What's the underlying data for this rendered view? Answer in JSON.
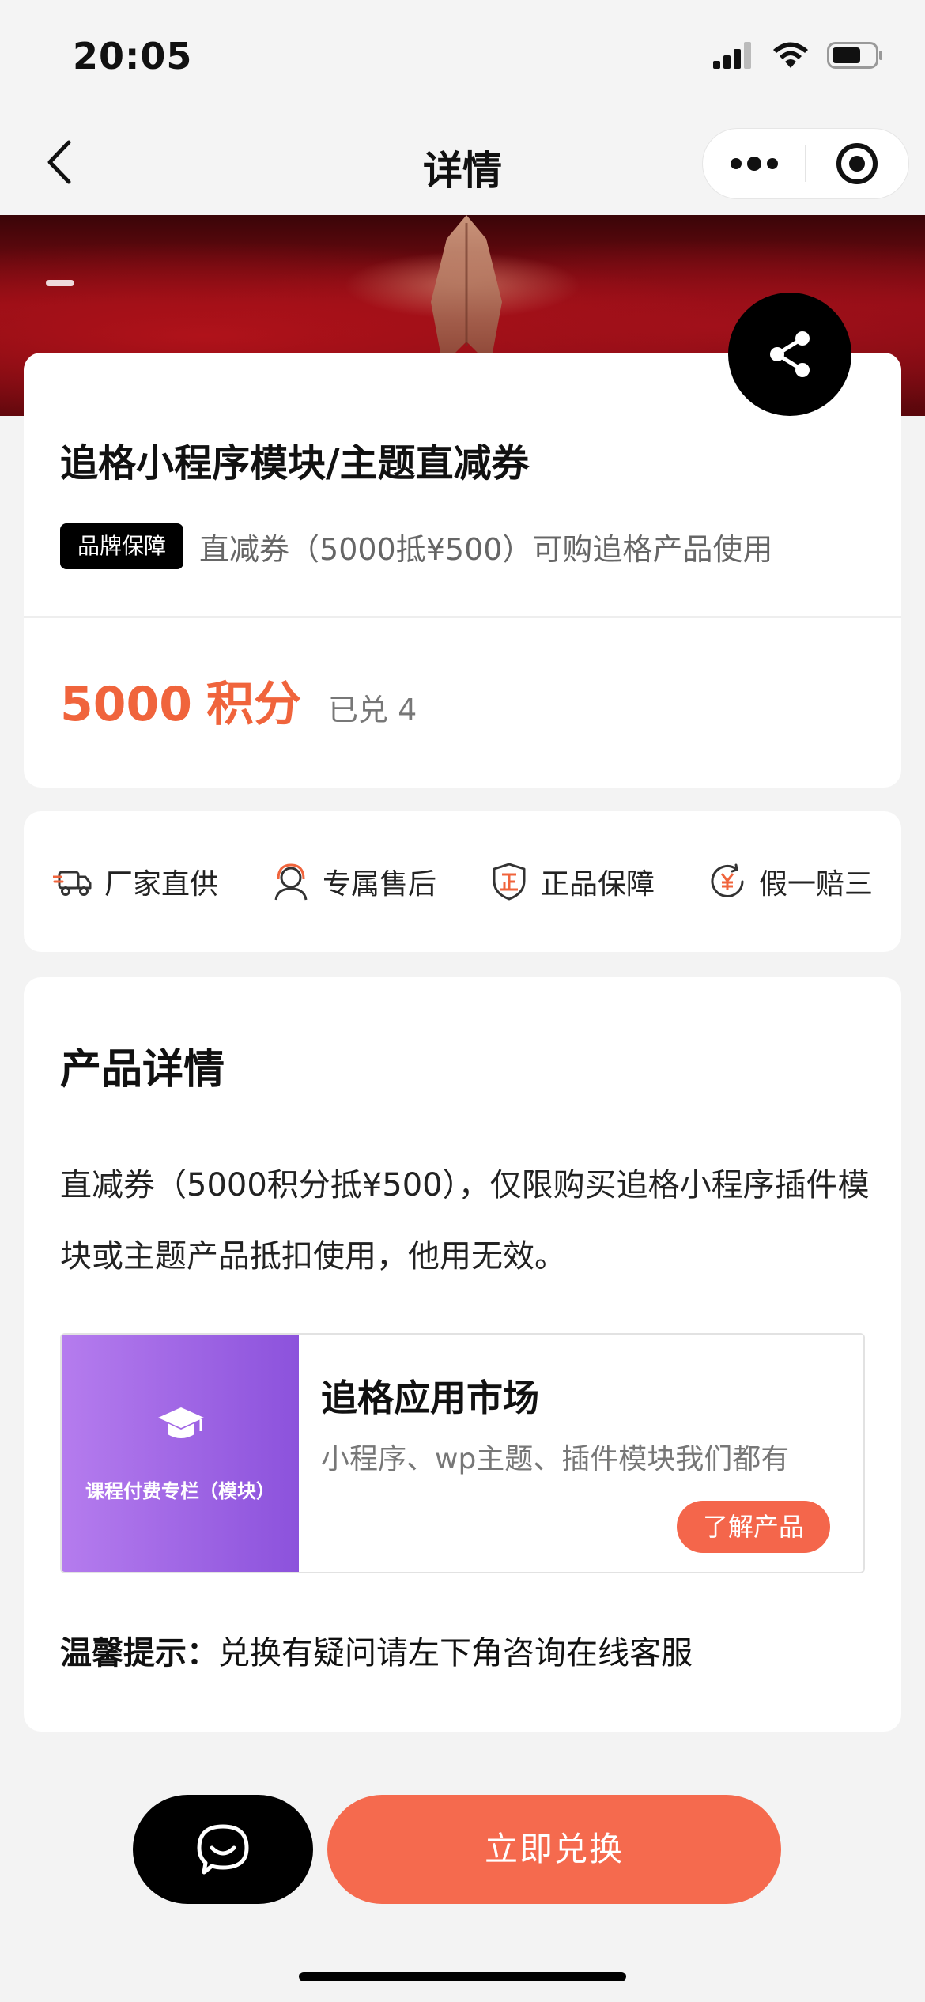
{
  "status_bar": {
    "time": "20:05"
  },
  "nav": {
    "title": "详情"
  },
  "product": {
    "title": "追格小程序模块/主题直减券",
    "brand_tag": "品牌保障",
    "tag_desc": "直减券（5000抵¥500）可购追格产品使用",
    "price_value": "5000",
    "price_unit": "积分",
    "redeemed": "已兑 4"
  },
  "guarantees": [
    {
      "label": "厂家直供",
      "icon": "truck-icon"
    },
    {
      "label": "专属售后",
      "icon": "service-agent-icon"
    },
    {
      "label": "正品保障",
      "icon": "authentic-shield-icon"
    },
    {
      "label": "假一赔三",
      "icon": "refund-yen-icon"
    }
  ],
  "detail": {
    "heading": "产品详情",
    "text": "直减券（5000积分抵¥500），仅限购买追格小程序插件模块或主题产品抵扣使用，他用无效。",
    "promo": {
      "left_text": "课程付费专栏（模块）",
      "title": "追格应用市场",
      "subtitle": "小程序、wp主题、插件模块我们都有",
      "button": "了解产品"
    },
    "tip_label": "温馨提示：",
    "tip_text": "兑换有疑问请左下角咨询在线客服"
  },
  "bottom_bar": {
    "redeem_label": "立即兑换"
  },
  "colors": {
    "accent": "#f56a4e",
    "price": "#f0643c",
    "promo_purple": "#8c52dc"
  }
}
